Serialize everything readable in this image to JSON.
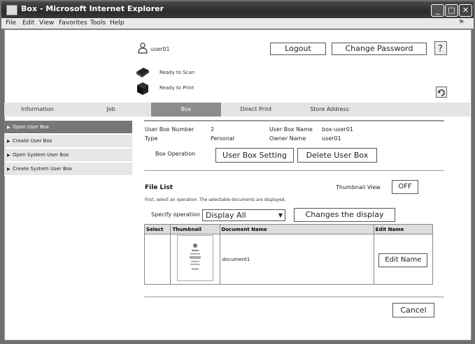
{
  "window": {
    "title": "Box - Microsoft Internet Explorer"
  },
  "menu": [
    "File",
    "Edit",
    "View",
    "Favorites",
    "Tools",
    "Help"
  ],
  "header": {
    "username": "user01",
    "logout_label": "Logout",
    "change_password_label": "Change Password",
    "ready_to_scan": "Ready to Scan",
    "ready_to_print": "Ready to Print"
  },
  "tabs": [
    "Information",
    "Job",
    "Box",
    "Direct Print",
    "Store Address"
  ],
  "sidebar": {
    "items": [
      {
        "label": "Open User Box",
        "active": true
      },
      {
        "label": "Create User Box",
        "active": false
      },
      {
        "label": "Open System User Box",
        "active": false
      },
      {
        "label": "Create System User Box",
        "active": false
      }
    ]
  },
  "boxinfo": {
    "number_label": "User Box Number",
    "number_value": "2",
    "name_label": "User Box Name",
    "name_value": "box-user01",
    "type_label": "Type",
    "type_value": "Personal",
    "owner_label": "Owner Name",
    "owner_value": "user01",
    "operation_label": "Box Operation",
    "setting_button": "User Box Setting",
    "delete_button": "Delete User Box"
  },
  "filelist": {
    "heading": "File List",
    "thumbnail_view_label": "Thumbnail View",
    "thumbnail_toggle": "OFF",
    "instruction": "First, select an operation. The selectable documents are displayed.",
    "specify_label": "Specify operation",
    "operation_selected": "Display All",
    "change_display_button": "Changes the display",
    "columns": [
      "Select",
      "Thumbnail",
      "Document Name",
      "Edit Name"
    ],
    "rows": [
      {
        "document_name": "document1",
        "edit_button": "Edit Name"
      }
    ]
  },
  "footer": {
    "cancel_label": "Cancel"
  }
}
